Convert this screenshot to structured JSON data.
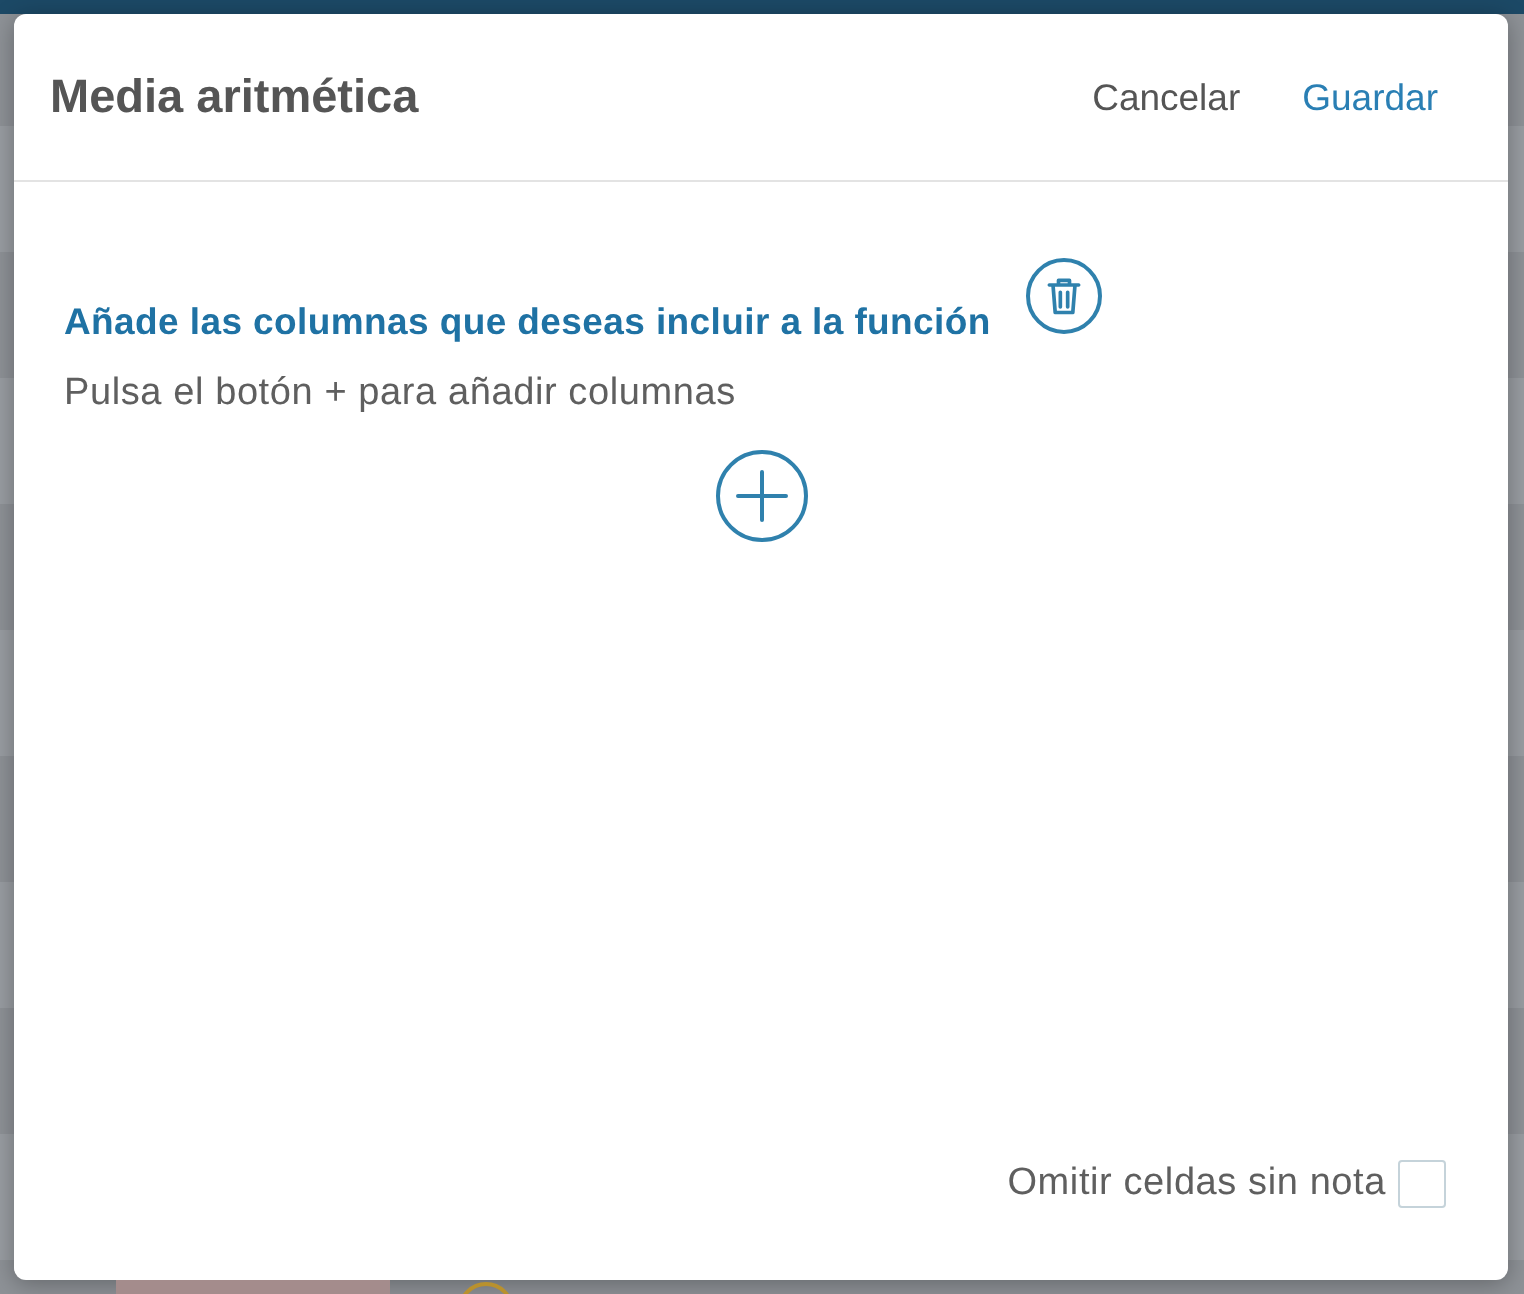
{
  "dialog": {
    "title": "Media aritmética",
    "actions": [
      {
        "label": "Cancelar",
        "kind": "secondary"
      },
      {
        "label": "Guardar",
        "kind": "primary"
      }
    ],
    "heading": "Añade las columnas que deseas incluir a la función",
    "hint": "Pulsa el botón + para añadir columnas",
    "omit_empty": {
      "label": "Omitir celdas sin nota",
      "checked": false
    }
  }
}
